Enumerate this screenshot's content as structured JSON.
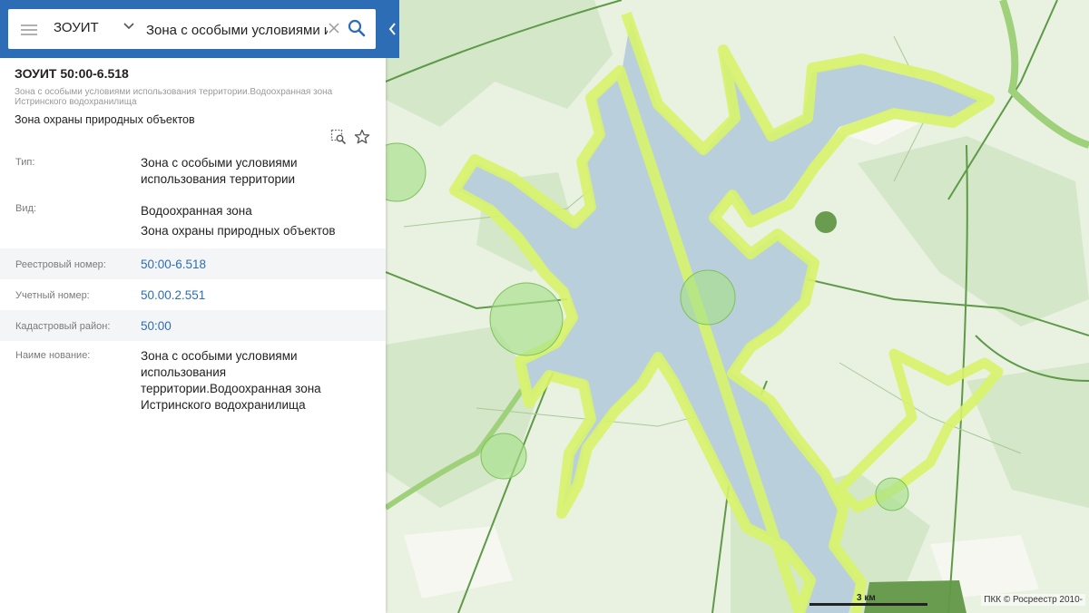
{
  "search": {
    "type_label": "ЗОУИТ",
    "query": "Зона с особыми условиями и"
  },
  "object": {
    "title": "ЗОУИТ 50:00-6.518",
    "full_name": "Зона с особыми условиями использования территории.Водоохранная зона Истринского водохранилища",
    "subtype": "Зона охраны природных объектов"
  },
  "attributes": [
    {
      "label": "Тип:",
      "lines": [
        "Зона с особыми условиями",
        "использования территории"
      ]
    },
    {
      "label": "Вид:",
      "lines": [
        "Водоохранная зона",
        "Зона охраны природных объектов"
      ]
    },
    {
      "label": "Реестровый номер:",
      "lines": [
        "50:00-6.518"
      ],
      "link": true
    },
    {
      "label": "Учетный номер:",
      "lines": [
        "50.00.2.551"
      ],
      "link": true
    },
    {
      "label": "Кадастровый район:",
      "lines": [
        "50:00"
      ],
      "link": true
    },
    {
      "label": "Наиме нование:",
      "lines": [
        "Зона с особыми условиями",
        "использования",
        "территории.Водоохранная зона",
        "Истринского водохранилища"
      ]
    }
  ],
  "map": {
    "scale_label": "3 км",
    "attribution": "ПКК © Росреестр 2010-",
    "colors": {
      "background": "#e9f1e1",
      "forest": "#d4e7c8",
      "water": "#b9cfdc",
      "zone_outline": "#d8f36a",
      "green_circle": "#a8e08a",
      "road": "#5e9a48",
      "accent": "#2d6db5"
    }
  }
}
